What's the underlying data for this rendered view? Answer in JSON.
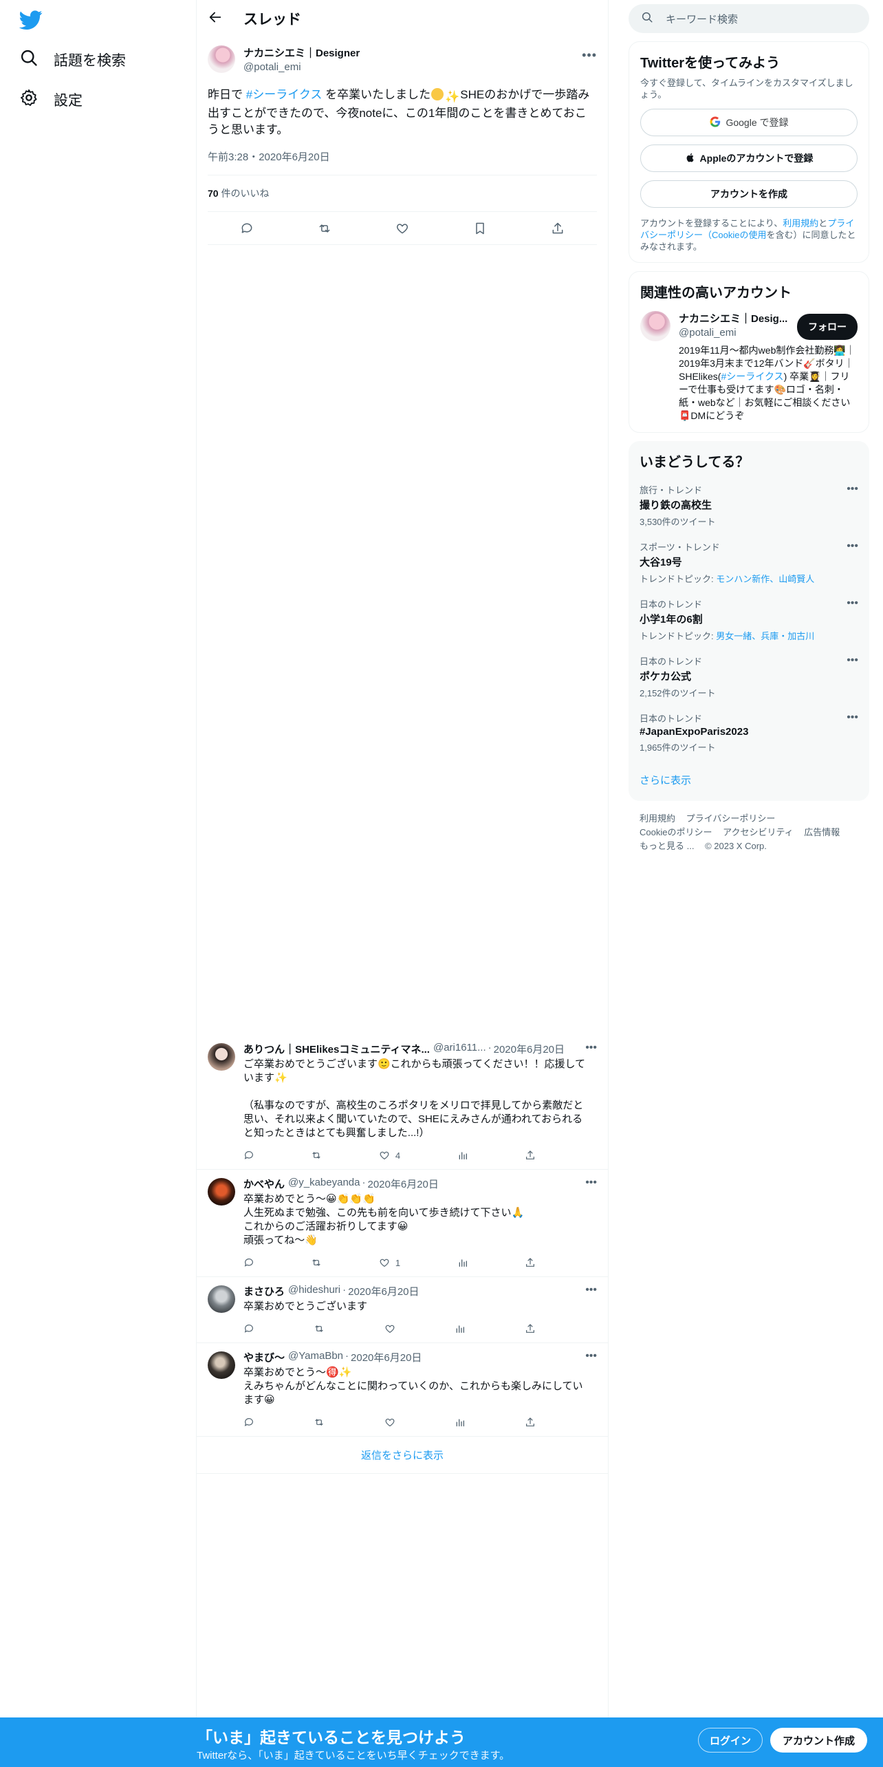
{
  "nav": {
    "explore_label": "話題を検索",
    "settings_label": "設定"
  },
  "thread": {
    "header_title": "スレッド",
    "author_name": "ナカニシエミ｜Designer",
    "author_handle": "@potali_emi",
    "text_part1": "昨日で ",
    "hashtag": "#シーライクス",
    "text_part2": " を卒業いたしました",
    "text_part3": "SHEのおかげで一歩踏み出すことができたので、今夜noteに、この1年間のことを書きとめておこうと思います。",
    "timestamp": "午前3:28・2020年6月20日",
    "likes_count": "70",
    "likes_label": " 件のいいね"
  },
  "replies": [
    {
      "name": "ありつん｜SHElikesコミュニティマネ...",
      "handle": "@ari1611...",
      "date": "2020年6月20日",
      "text": "ご卒業おめでとうございます🙂これからも頑張ってください！！応援しています✨\n\n（私事なのですが、高校生のころポタリをメリロで拝見してから素敵だと思い、それ以来よく聞いていたので、SHEにえみさんが通われておられると知ったときはとても興奮しました...!）",
      "likes": "4"
    },
    {
      "name": "かべやん",
      "handle": "@y_kabeyanda",
      "date": "2020年6月20日",
      "text": "卒業おめでとう～😀👏👏👏\n人生死ぬまで勉強、この先も前を向いて歩き続けて下さい🙏\nこれからのご活躍お祈りしてます😀\n頑張ってね～👋",
      "likes": "1"
    },
    {
      "name": "まさひろ",
      "handle": "@hideshuri",
      "date": "2020年6月20日",
      "text": "卒業おめでとうございます",
      "likes": ""
    },
    {
      "name": "やまび～",
      "handle": "@YamaBbn",
      "date": "2020年6月20日",
      "text": "卒業おめでとう〜🉐✨\nえみちゃんがどんなことに関わっていくのか、これからも楽しみにしています😀",
      "likes": ""
    }
  ],
  "show_more_replies": "返信をさらに表示",
  "sidebar": {
    "search_placeholder": "キーワード検索",
    "signup": {
      "title": "Twitterを使ってみよう",
      "subtitle": "今すぐ登録して、タイムラインをカスタマイズしましょう。",
      "google_label": "Google で登録",
      "apple_label": "Appleのアカウントで登録",
      "create_label": "アカウントを作成",
      "legal_prefix": "アカウントを登録することにより、",
      "legal_terms": "利用規約",
      "legal_and": "と",
      "legal_privacy": "プライバシーポリシー（Cookieの使用",
      "legal_suffix": "を含む）に同意したとみなされます。"
    },
    "related": {
      "title": "関連性の高いアカウント",
      "name": "ナカニシエミ｜Desig...",
      "handle": "@potali_emi",
      "follow_label": "フォロー",
      "bio_part1": "2019年11月〜都内web制作会社勤務👩‍💻｜2019年3月末まで12年バンド🎸ボタリ｜SHElikes(",
      "bio_hashtag": "#シーライクス",
      "bio_part2": ") 卒業👩‍🎓｜フリーで仕事も受けてます🎨ロゴ・名刺・紙・webなど｜お気軽にご相談ください📮DMにどうぞ"
    },
    "trends": {
      "title": "いまどうしてる？",
      "items": [
        {
          "category": "旅行・トレンド",
          "name": "撮り鉄の高校生",
          "meta_prefix": "3,530件のツイート",
          "meta_links": ""
        },
        {
          "category": "スポーツ・トレンド",
          "name": "大谷19号",
          "meta_prefix": "トレンドトピック: ",
          "meta_links": "モンハン新作、山崎賢人"
        },
        {
          "category": "日本のトレンド",
          "name": "小学1年の6割",
          "meta_prefix": "トレンドトピック: ",
          "meta_links": "男女一緒、兵庫・加古川"
        },
        {
          "category": "日本のトレンド",
          "name": "ポケカ公式",
          "meta_prefix": "2,152件のツイート",
          "meta_links": ""
        },
        {
          "category": "日本のトレンド",
          "name": "#JapanExpoParis2023",
          "meta_prefix": "1,965件のツイート",
          "meta_links": ""
        }
      ],
      "show_more": "さらに表示"
    },
    "footer": {
      "line1": [
        "利用規約",
        "プライバシーポリシー"
      ],
      "line2": [
        "Cookieのポリシー",
        "アクセシビリティ",
        "広告情報"
      ],
      "line3": [
        "もっと見る ...",
        "© 2023 X Corp."
      ]
    }
  },
  "bottom_bar": {
    "title": "「いま」起きていることを見つけよう",
    "subtitle": "Twitterなら、「いま」起きていることをいち早くチェックできます。",
    "login_label": "ログイン",
    "signup_label": "アカウント作成"
  },
  "colors": {
    "accent": "#1d9bf0",
    "text": "#0f1419",
    "muted": "#536471"
  }
}
